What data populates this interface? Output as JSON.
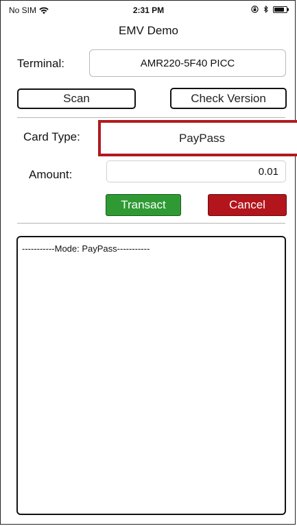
{
  "status_bar": {
    "carrier": "No SIM",
    "time": "2:31 PM",
    "battery_level": 0.85
  },
  "nav": {
    "title": "EMV Demo"
  },
  "terminal": {
    "label": "Terminal:",
    "value": "AMR220-5F40 PICC"
  },
  "buttons": {
    "scan": "Scan",
    "check_version": "Check Version",
    "transact": "Transact",
    "cancel": "Cancel"
  },
  "card_type": {
    "label": "Card Type:",
    "value": "PayPass"
  },
  "amount": {
    "label": "Amount:",
    "value": "0.01"
  },
  "log": {
    "text": "-----------Mode: PayPass-----------"
  },
  "colors": {
    "highlight": "#b01a1e",
    "transact": "#2f9a34",
    "cancel": "#b3151c"
  },
  "icons": [
    "wifi-icon",
    "orientation-lock-icon",
    "bluetooth-icon",
    "battery-icon"
  ]
}
